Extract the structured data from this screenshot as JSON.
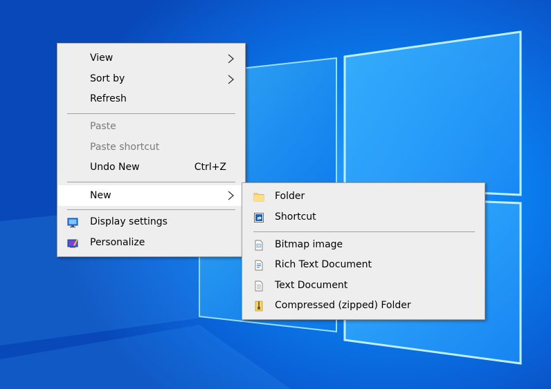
{
  "context_menu": {
    "items": [
      {
        "label": "View",
        "has_submenu": true
      },
      {
        "label": "Sort by",
        "has_submenu": true
      },
      {
        "label": "Refresh"
      },
      {
        "label": "Paste",
        "disabled": true
      },
      {
        "label": "Paste shortcut",
        "disabled": true
      },
      {
        "label": "Undo New",
        "shortcut": "Ctrl+Z"
      },
      {
        "label": "New",
        "has_submenu": true,
        "highlighted": true
      },
      {
        "label": "Display settings",
        "icon": "display-settings-icon"
      },
      {
        "label": "Personalize",
        "icon": "personalize-icon"
      }
    ]
  },
  "new_submenu": {
    "items": [
      {
        "label": "Folder",
        "icon": "folder-icon"
      },
      {
        "label": "Shortcut",
        "icon": "shortcut-icon"
      },
      {
        "label": "Bitmap image",
        "icon": "bitmap-image-icon"
      },
      {
        "label": "Rich Text Document",
        "icon": "rich-text-document-icon"
      },
      {
        "label": "Text Document",
        "icon": "text-document-icon"
      },
      {
        "label": "Compressed (zipped) Folder",
        "icon": "zipped-folder-icon"
      }
    ]
  },
  "colors": {
    "desktop_blue": "#0a7ff0",
    "menu_background": "#eeeeee",
    "highlight_background": "#ffffff",
    "disabled_text": "#7a7a7a"
  }
}
